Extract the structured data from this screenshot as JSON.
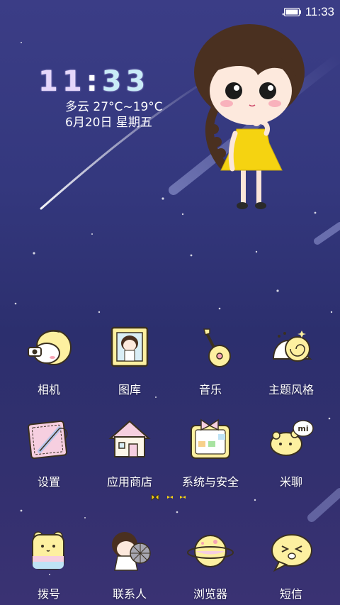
{
  "status_bar": {
    "time": "11:33",
    "battery_icon": "battery-icon"
  },
  "clock_widget": {
    "time_digits": [
      "1",
      "1",
      ":",
      "3",
      "3"
    ],
    "weather": "多云 27°C~19°C",
    "date": "6月20日 星期五"
  },
  "apps": {
    "row1": [
      {
        "label": "相机",
        "icon": "camera-icon"
      },
      {
        "label": "图库",
        "icon": "gallery-icon"
      },
      {
        "label": "音乐",
        "icon": "music-icon"
      },
      {
        "label": "主题风格",
        "icon": "theme-icon"
      }
    ],
    "row2": [
      {
        "label": "设置",
        "icon": "settings-icon"
      },
      {
        "label": "应用商店",
        "icon": "app-store-icon"
      },
      {
        "label": "系统与安全",
        "icon": "security-icon"
      },
      {
        "label": "米聊",
        "icon": "miliao-icon",
        "badge": "mi"
      }
    ]
  },
  "dock": [
    {
      "label": "拨号",
      "icon": "dialer-icon"
    },
    {
      "label": "联系人",
      "icon": "contacts-icon"
    },
    {
      "label": "浏览器",
      "icon": "browser-icon"
    },
    {
      "label": "短信",
      "icon": "messages-icon"
    }
  ],
  "colors": {
    "bg_top": "#3b3d86",
    "bg_bottom": "#3a3273",
    "clock_digit_purple": "#d8c8f5",
    "clock_digit_blue": "#bfe3f5",
    "icon_yellow": "#fdf3a7",
    "icon_pink": "#f6cfe0"
  },
  "page_indicator": {
    "pages": 3,
    "current": 1
  }
}
